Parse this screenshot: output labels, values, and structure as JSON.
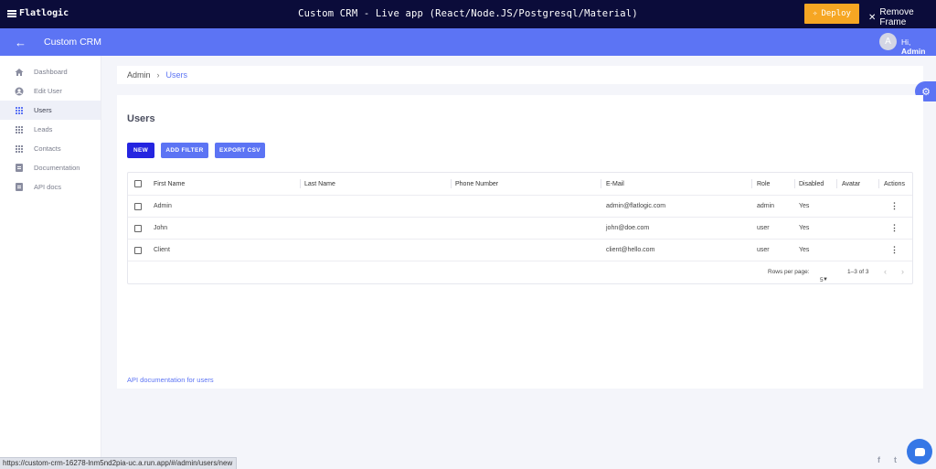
{
  "frame": {
    "logo": "Flatlogic",
    "title": "Custom CRM - Live app (React/Node.JS/Postgresql/Material)",
    "deploy_label": "Deploy",
    "remove_frame_label": "Remove Frame"
  },
  "header": {
    "app_title": "Custom CRM",
    "avatar_initial": "A",
    "greeting_prefix": "Hi,",
    "user_name": "Admin"
  },
  "sidebar": {
    "items": [
      {
        "label": "Dashboard",
        "icon": "home-icon"
      },
      {
        "label": "Edit User",
        "icon": "account-circle-icon"
      },
      {
        "label": "Users",
        "icon": "grid-icon",
        "active": true
      },
      {
        "label": "Leads",
        "icon": "grid-icon"
      },
      {
        "label": "Contacts",
        "icon": "grid-icon"
      },
      {
        "label": "Documentation",
        "icon": "document-icon"
      },
      {
        "label": "API docs",
        "icon": "document-icon"
      }
    ]
  },
  "breadcrumb": {
    "root": "Admin",
    "separator": "›",
    "current": "Users"
  },
  "page": {
    "title": "Users",
    "buttons": {
      "new": "NEW",
      "add_filter": "ADD FILTER",
      "export_csv": "EXPORT CSV"
    },
    "api_link": "API documentation for users"
  },
  "table": {
    "columns": [
      "First Name",
      "Last Name",
      "Phone Number",
      "E-Mail",
      "Role",
      "Disabled",
      "Avatar",
      "Actions"
    ],
    "rows": [
      {
        "first_name": "Admin",
        "last_name": "",
        "phone": "",
        "email": "admin@flatlogic.com",
        "role": "admin",
        "disabled": "Yes",
        "avatar": ""
      },
      {
        "first_name": "John",
        "last_name": "",
        "phone": "",
        "email": "john@doe.com",
        "role": "user",
        "disabled": "Yes",
        "avatar": ""
      },
      {
        "first_name": "Client",
        "last_name": "",
        "phone": "",
        "email": "client@hello.com",
        "role": "user",
        "disabled": "Yes",
        "avatar": ""
      }
    ],
    "pagination": {
      "rows_per_page_label": "Rows per page:",
      "rows_per_page": "5",
      "range": "1–3 of 3"
    }
  },
  "status_bar": {
    "url": "https://custom-crm-16278-lnm5nd2pia-uc.a.run.app/#/admin/users/new"
  },
  "colors": {
    "frame_bg": "#0b0c3a",
    "primary": "#5c74f4",
    "new_button": "#2525e0",
    "deploy": "#f6a623"
  }
}
